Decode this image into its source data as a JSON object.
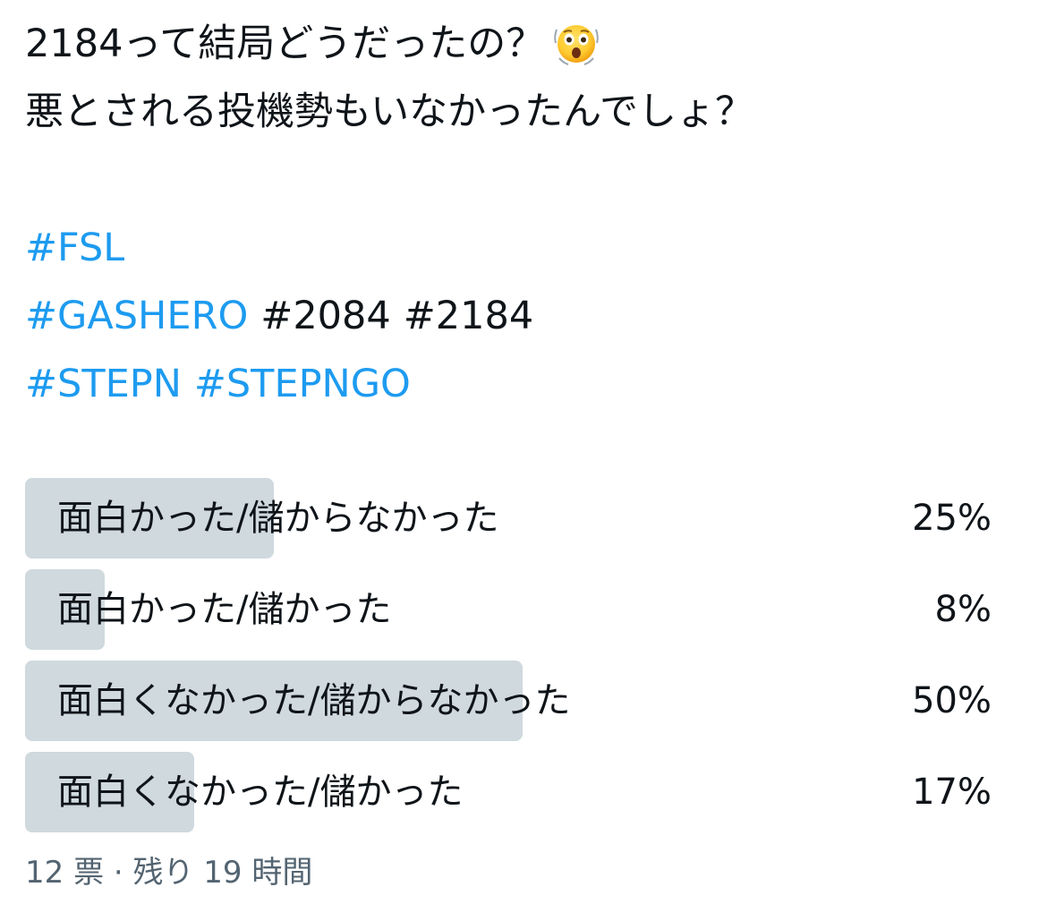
{
  "tweet": {
    "line1": "2184って結局どうだったの？",
    "line1_emoji": "astonished-face",
    "line2": "悪とされる投機勢もいなかったんでしょ？",
    "tags_line1": [
      "#FSL"
    ],
    "tags_line2": [
      "#GASHERO",
      "#2084",
      "#2184"
    ],
    "tags_line3": [
      "#STEPN",
      "#STEPNGO"
    ]
  },
  "poll": {
    "options": [
      {
        "label": "面白かった/儲からなかった",
        "percent_text": "25%",
        "fraction": 0.25
      },
      {
        "label": "面白かった/儲かった",
        "percent_text": "8%",
        "fraction": 0.08
      },
      {
        "label": "面白くなかった/儲からなかった",
        "percent_text": "50%",
        "fraction": 0.5
      },
      {
        "label": "面白くなかった/儲かった",
        "percent_text": "17%",
        "fraction": 0.17
      }
    ],
    "footer": "12 票 · 残り 19 時間",
    "colors": {
      "bar": "#cfd9de",
      "hashtag": "#1d9bf0",
      "muted": "#536471"
    }
  }
}
